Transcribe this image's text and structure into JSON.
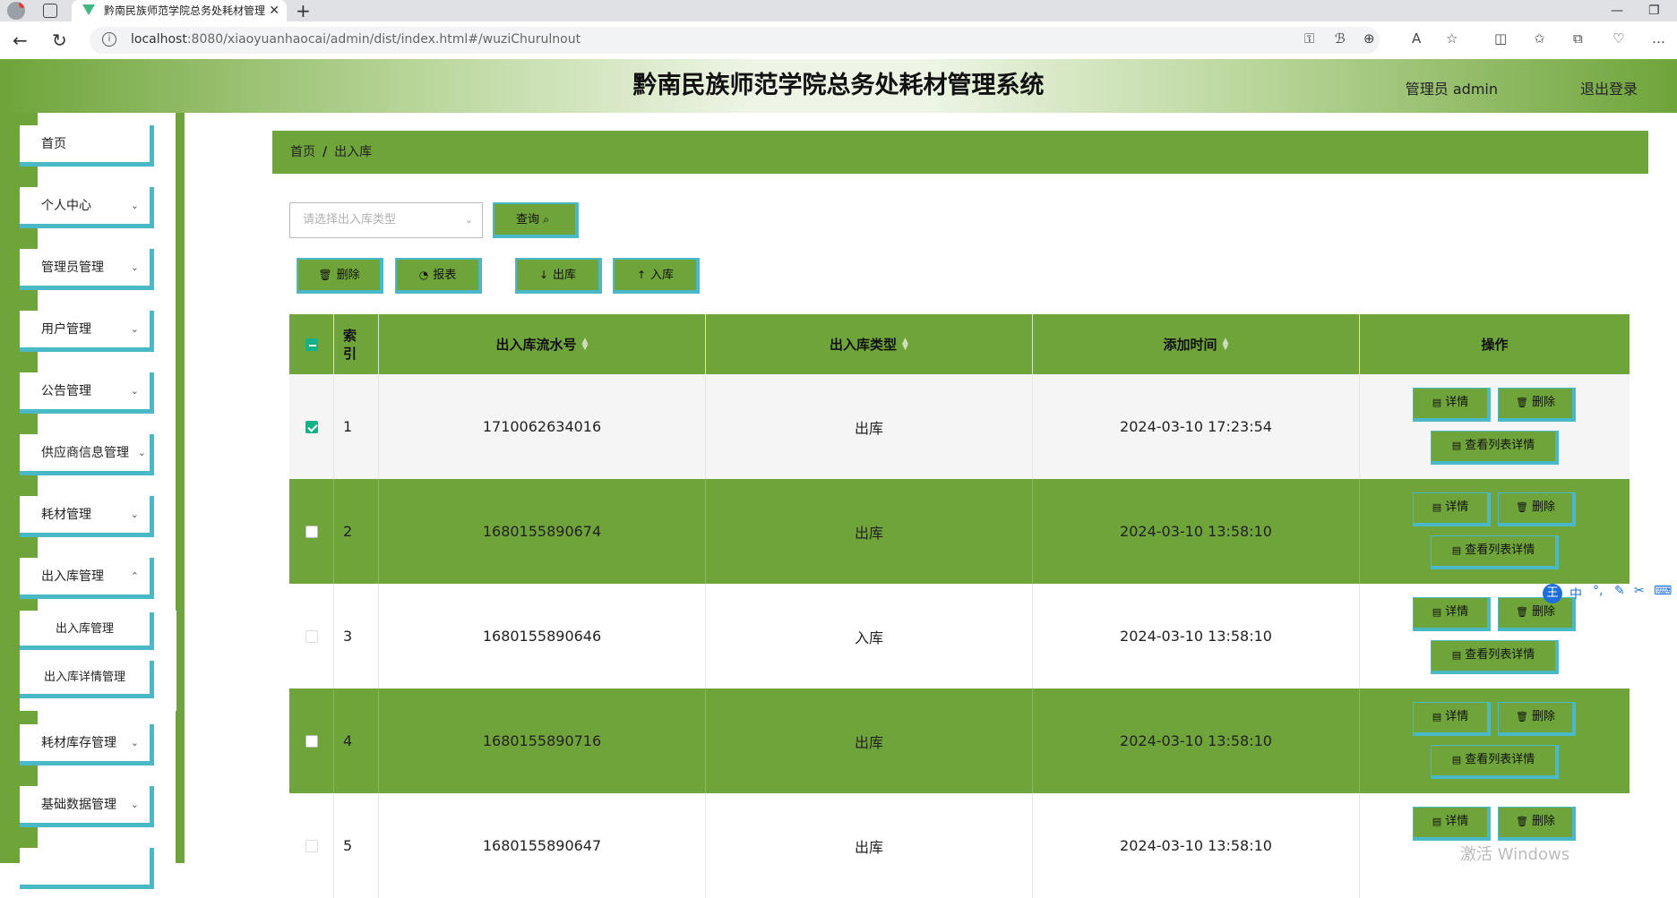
{
  "browser": {
    "tab_title": "黔南民族师范学院总务处耗材管理",
    "url_host": "localhost",
    "url_rest": ":8080/xiaoyuanhaocai/admin/dist/index.html#/wuziChurulnout"
  },
  "header": {
    "title": "黔南民族师范学院总务处耗材管理系统",
    "user": "管理员 admin",
    "logout": "退出登录"
  },
  "sidebar": {
    "items": [
      {
        "label": "首页"
      },
      {
        "label": "个人中心"
      },
      {
        "label": "管理员管理"
      },
      {
        "label": "用户管理"
      },
      {
        "label": "公告管理"
      },
      {
        "label": "供应商信息管理"
      },
      {
        "label": "耗材管理"
      },
      {
        "label": "出入库管理"
      }
    ],
    "subitems": [
      {
        "label": "出入库管理"
      },
      {
        "label": "出入库详情管理"
      }
    ],
    "items_after": [
      {
        "label": "耗材库存管理"
      },
      {
        "label": "基础数据管理"
      }
    ]
  },
  "breadcrumb": {
    "home": "首页",
    "current": "出入库"
  },
  "search": {
    "placeholder": "请选择出入库类型",
    "query_label": "查询"
  },
  "actions": {
    "delete": "删除",
    "report": "报表",
    "out": "出库",
    "in": "入库"
  },
  "table": {
    "headers": {
      "index": "索引",
      "serial": "出入库流水号",
      "type": "出入库类型",
      "time": "添加时间",
      "ops": "操作"
    },
    "op_labels": {
      "detail": "详情",
      "delete": "删除",
      "list_detail": "查看列表详情"
    },
    "rows": [
      {
        "index": "1",
        "serial": "1710062634016",
        "type": "出库",
        "time": "2024-03-10 17:23:54"
      },
      {
        "index": "2",
        "serial": "1680155890674",
        "type": "出库",
        "time": "2024-03-10 13:58:10"
      },
      {
        "index": "3",
        "serial": "1680155890646",
        "type": "入库",
        "time": "2024-03-10 13:58:10"
      },
      {
        "index": "4",
        "serial": "1680155890716",
        "type": "出库",
        "time": "2024-03-10 13:58:10"
      },
      {
        "index": "5",
        "serial": "1680155890647",
        "type": "出库",
        "time": "2024-03-10 13:58:10"
      }
    ]
  },
  "ime": {
    "wang": "王",
    "zhong": "中"
  },
  "watermark": "激活 Windows",
  "colors": {
    "accent_green": "#6fa43a",
    "border_teal": "#4ab9c7",
    "checkbox": "#15b28a"
  }
}
